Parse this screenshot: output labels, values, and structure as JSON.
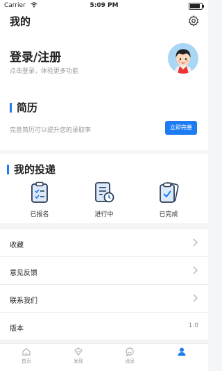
{
  "status_bar": {
    "carrier": "Carrier",
    "time": "5:09 PM"
  },
  "header": {
    "title": "我的"
  },
  "login": {
    "title": "登录/注册",
    "subtitle": "点击登录，体验更多功能"
  },
  "resume": {
    "title": "简历",
    "subtitle": "完善简历可以提升您的录取率",
    "button": "立即完善"
  },
  "deliveries": {
    "title": "我的投递",
    "items": [
      {
        "label": "已报名",
        "icon": "clipboard-list-icon"
      },
      {
        "label": "进行中",
        "icon": "clock-document-icon"
      },
      {
        "label": "已完成",
        "icon": "checked-clipboard-icon"
      }
    ]
  },
  "menu": {
    "items": [
      {
        "label": "收藏"
      },
      {
        "label": "意见反馈"
      },
      {
        "label": "联系我们"
      },
      {
        "label": "版本",
        "value": "1.0"
      }
    ]
  },
  "tabs": [
    {
      "label": "首页",
      "icon": "home-icon"
    },
    {
      "label": "发现",
      "icon": "discover-icon"
    },
    {
      "label": "消息",
      "icon": "message-icon"
    },
    {
      "label": "",
      "icon": "profile-icon",
      "active": true
    }
  ],
  "colors": {
    "accent": "#1e7cf2"
  }
}
